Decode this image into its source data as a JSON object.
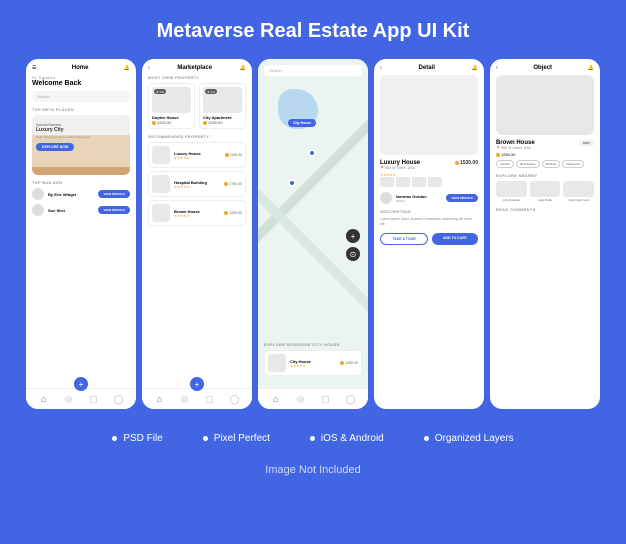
{
  "header": {
    "title": "Metaverse Real Estate App UI Kit"
  },
  "screens": {
    "home": {
      "title": "Home",
      "greeting": "Hi, Theodora",
      "welcome": "Welcome Back",
      "search_placeholder": "Search",
      "top_places_label": "TOP META PLACES",
      "hero": {
        "subtitle": "Special Express",
        "title": "Luxury City",
        "desc": "Near shopping mall & modern living area",
        "cta": "EXPLORE NOW"
      },
      "top_builder_label": "TOP BUILDER",
      "builders": [
        {
          "name": "By Eric Widget",
          "cta": "VIEW PROFILE"
        },
        {
          "name": "Sue Shei",
          "cta": "VIEW PROFILE"
        }
      ]
    },
    "marketplace": {
      "title": "Marketplace",
      "most_view_label": "MOST VIEW PROPERTY",
      "cards": [
        {
          "rating": "4.8",
          "name": "Duplex House",
          "price": "3200.00"
        },
        {
          "rating": "4.6",
          "name": "City Apartment",
          "price": "1530.00"
        }
      ],
      "recommended_label": "RECOMMENDED PROPERTY",
      "list": [
        {
          "name": "Luxury House",
          "price": "1140.00"
        },
        {
          "name": "Hospital Building",
          "price": "2750.00"
        },
        {
          "name": "Brown House",
          "price": "1250.00"
        }
      ]
    },
    "map": {
      "search_placeholder": "Search",
      "pin_label": "City House",
      "explore_label": "EXPLORE RIVERSIDE CITY HOUSE",
      "item": {
        "name": "City House",
        "price": "1250.00"
      }
    },
    "detail": {
      "title": "Detail",
      "name": "Luxury House",
      "location": "869 W Street, USA",
      "price": "1530.00",
      "seller": {
        "name": "Norman Gordon",
        "role": "Builder",
        "cta": "VIEW PROFILE"
      },
      "desc_label": "DESCRIPTION",
      "desc": "Lorem ipsum dolor sit amet consectetur adipiscing elit diam elit.",
      "tour_cta": "TAKE A TOUR",
      "cart_cta": "ADD TO CART"
    },
    "object": {
      "title": "Object",
      "name": "Brown House",
      "location": "869 W Street, USA",
      "price": "1250.00",
      "edit": "EDIT",
      "tags": [
        "Garden",
        "Real Estate",
        "Building",
        "Metaverse"
      ],
      "explore_label": "EXPLORE NEARBY",
      "nearby": [
        {
          "label": "City Hospital"
        },
        {
          "label": "Cafe Bobo"
        },
        {
          "label": "Gold Fast Food"
        }
      ],
      "comments_label": "READ COMMENTS"
    }
  },
  "features": [
    "PSD File",
    "Pixel Perfect",
    "iOS & Android",
    "Organized Layers"
  ],
  "footer": "Image Not Included"
}
